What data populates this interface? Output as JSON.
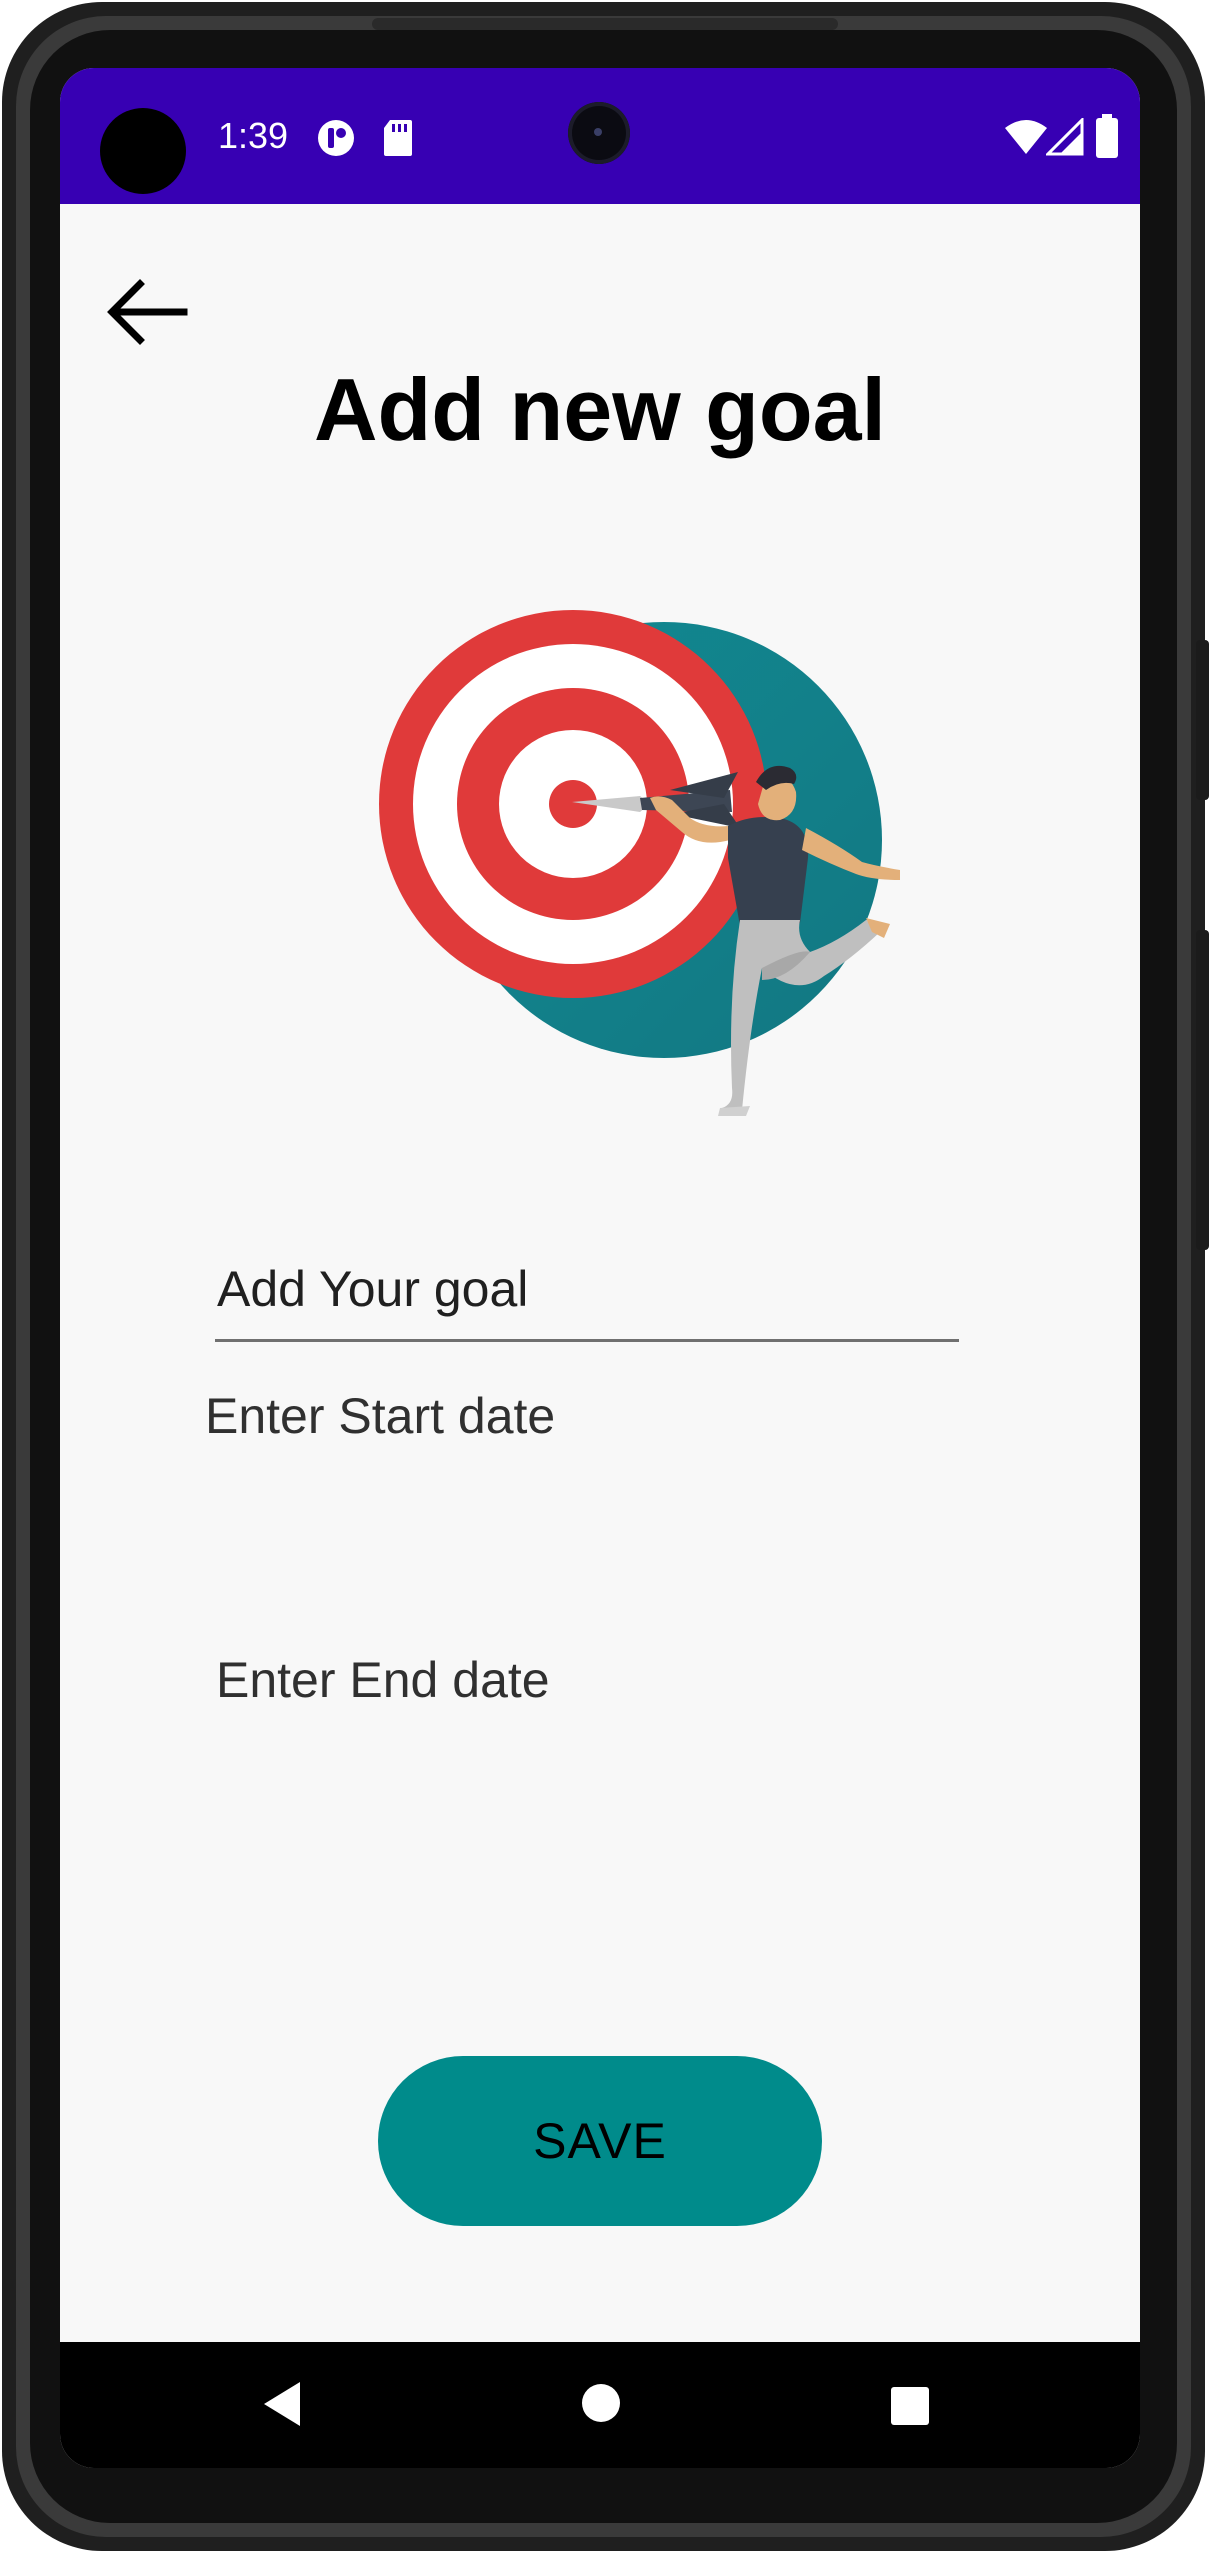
{
  "status_bar": {
    "time": "1:39",
    "background_color": "#3700b3",
    "icons": [
      "notification-icon",
      "sd-card-icon",
      "wifi-icon",
      "cell-signal-icon",
      "battery-icon"
    ]
  },
  "toolbar": {
    "back_icon": "arrow-back-icon"
  },
  "page": {
    "title": "Add new goal",
    "illustration": "dartboard-target-illustration"
  },
  "form": {
    "goal_placeholder": "Add Your goal",
    "goal_value": "",
    "start_date_label": "Enter Start date",
    "end_date_label": "Enter End date",
    "save_label": "SAVE",
    "accent_color": "#008b8b"
  },
  "nav_bar": {
    "icons": [
      "nav-back-icon",
      "nav-home-icon",
      "nav-recents-icon"
    ]
  }
}
